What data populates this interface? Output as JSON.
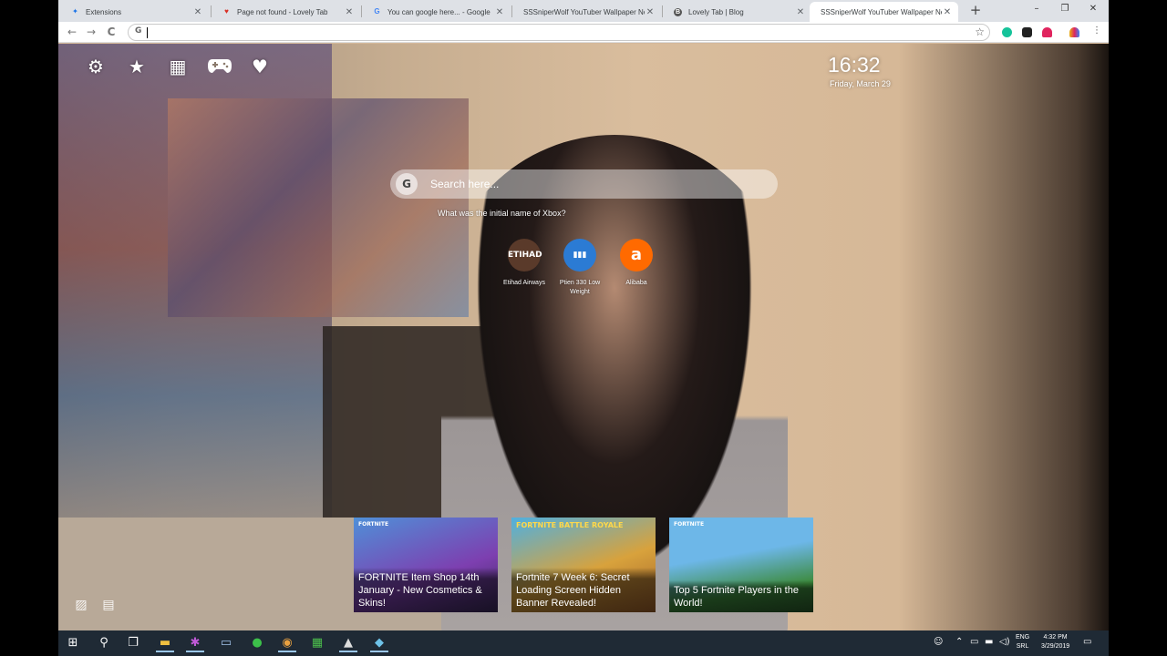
{
  "tabs": [
    {
      "title": "Extensions",
      "favicon": "puzzle-icon",
      "color": "#1a73e8"
    },
    {
      "title": "Page not found - Lovely Tab",
      "favicon": "heart-icon",
      "color": "#d93025"
    },
    {
      "title": "You can google here... - Google",
      "favicon": "google-icon",
      "color": "#4285f4"
    },
    {
      "title": "SSSniperWolf YouTuber Wallpaper Ne",
      "favicon": "none",
      "color": ""
    },
    {
      "title": "Lovely Tab | Blog",
      "favicon": "blogger-icon",
      "color": "#555555"
    },
    {
      "title": "SSSniperWolf YouTuber Wallpaper Ne",
      "favicon": "none",
      "color": ""
    }
  ],
  "window_controls": {
    "minimize": "–",
    "restore": "❐",
    "close": "✕"
  },
  "new_tab": "+",
  "toolbar": {
    "back": "←",
    "forward": "→",
    "reload": "C",
    "omnibox_g": "G",
    "omnibox_value": "",
    "star": "☆",
    "menu": "⋮"
  },
  "extensions": [
    {
      "name": "grammarly-icon",
      "color": "#15c39a"
    },
    {
      "name": "shield-extension-icon",
      "color": "#222222"
    },
    {
      "name": "heart-extension-icon",
      "color": "#e0245e"
    },
    {
      "name": "multicolor-heart-icon",
      "color": "#e9b10e"
    }
  ],
  "newtab_page": {
    "top_icons": [
      {
        "name": "gear-icon",
        "glyph": "⚙"
      },
      {
        "name": "star-icon",
        "glyph": "★"
      },
      {
        "name": "apps-grid-icon",
        "glyph": "▦"
      },
      {
        "name": "gamepad-icon",
        "glyph": "🎮"
      },
      {
        "name": "heart-icon",
        "glyph": "♥"
      }
    ],
    "clock": "16:32",
    "date": "Friday, March 29",
    "search_icon": "G",
    "search_placeholder": "Search here...",
    "trivia": "What was the initial name of Xbox?",
    "shortcuts": [
      {
        "label": "Etihad Airways",
        "icon_text": "ETIHAD",
        "color": "#8a5a3c"
      },
      {
        "label": "Ptien 330 Low Weight",
        "icon_text": "▮▮▮",
        "color": "#2b7bd4"
      },
      {
        "label": "Alibaba",
        "icon_text": "a",
        "color": "#ff6a00"
      }
    ],
    "news": [
      {
        "brand": "FORTNITE",
        "title": "FORTNITE Item Shop 14th January - New Cosmetics & Skins!",
        "colors": [
          "#4f90d8",
          "#7d3fb0"
        ]
      },
      {
        "brand": "FORTNITE BATTLE ROYALE",
        "title": "Fortnite 7 Week 6: Secret Loading Screen Hidden Banner Revealed!",
        "colors": [
          "#4fb0e0",
          "#d8a23c"
        ]
      },
      {
        "brand": "FORTNITE",
        "title": "Top 5 Fortnite Players in the World!",
        "colors": [
          "#6db7e8",
          "#3c8a3c"
        ]
      }
    ],
    "bottom_icons": [
      {
        "name": "image-icon",
        "glyph": "▨"
      },
      {
        "name": "notes-icon",
        "glyph": "▤"
      }
    ]
  },
  "taskbar": {
    "apps": [
      {
        "name": "windows-start-icon",
        "glyph": "⊞"
      },
      {
        "name": "search-icon",
        "glyph": "⚲"
      },
      {
        "name": "task-view-icon",
        "glyph": "❐"
      },
      {
        "name": "file-explorer-icon",
        "glyph": "▬"
      },
      {
        "name": "paint-app-icon",
        "glyph": "✱"
      },
      {
        "name": "notepad-icon",
        "glyph": "▭"
      },
      {
        "name": "green-app-icon",
        "glyph": "●"
      },
      {
        "name": "chrome-icon",
        "glyph": "◉"
      },
      {
        "name": "spreadsheet-icon",
        "glyph": "▦"
      },
      {
        "name": "photos-icon",
        "glyph": "▲"
      },
      {
        "name": "tool-icon",
        "glyph": "◆"
      }
    ],
    "tray": {
      "people": "☺",
      "chevron": "⌃",
      "network": "▭",
      "wifi": "▬",
      "volume": "◁)",
      "lang_top": "ENG",
      "lang_bottom": "SRL",
      "time": "4:32 PM",
      "date": "3/29/2019",
      "notifications": "▭"
    }
  }
}
